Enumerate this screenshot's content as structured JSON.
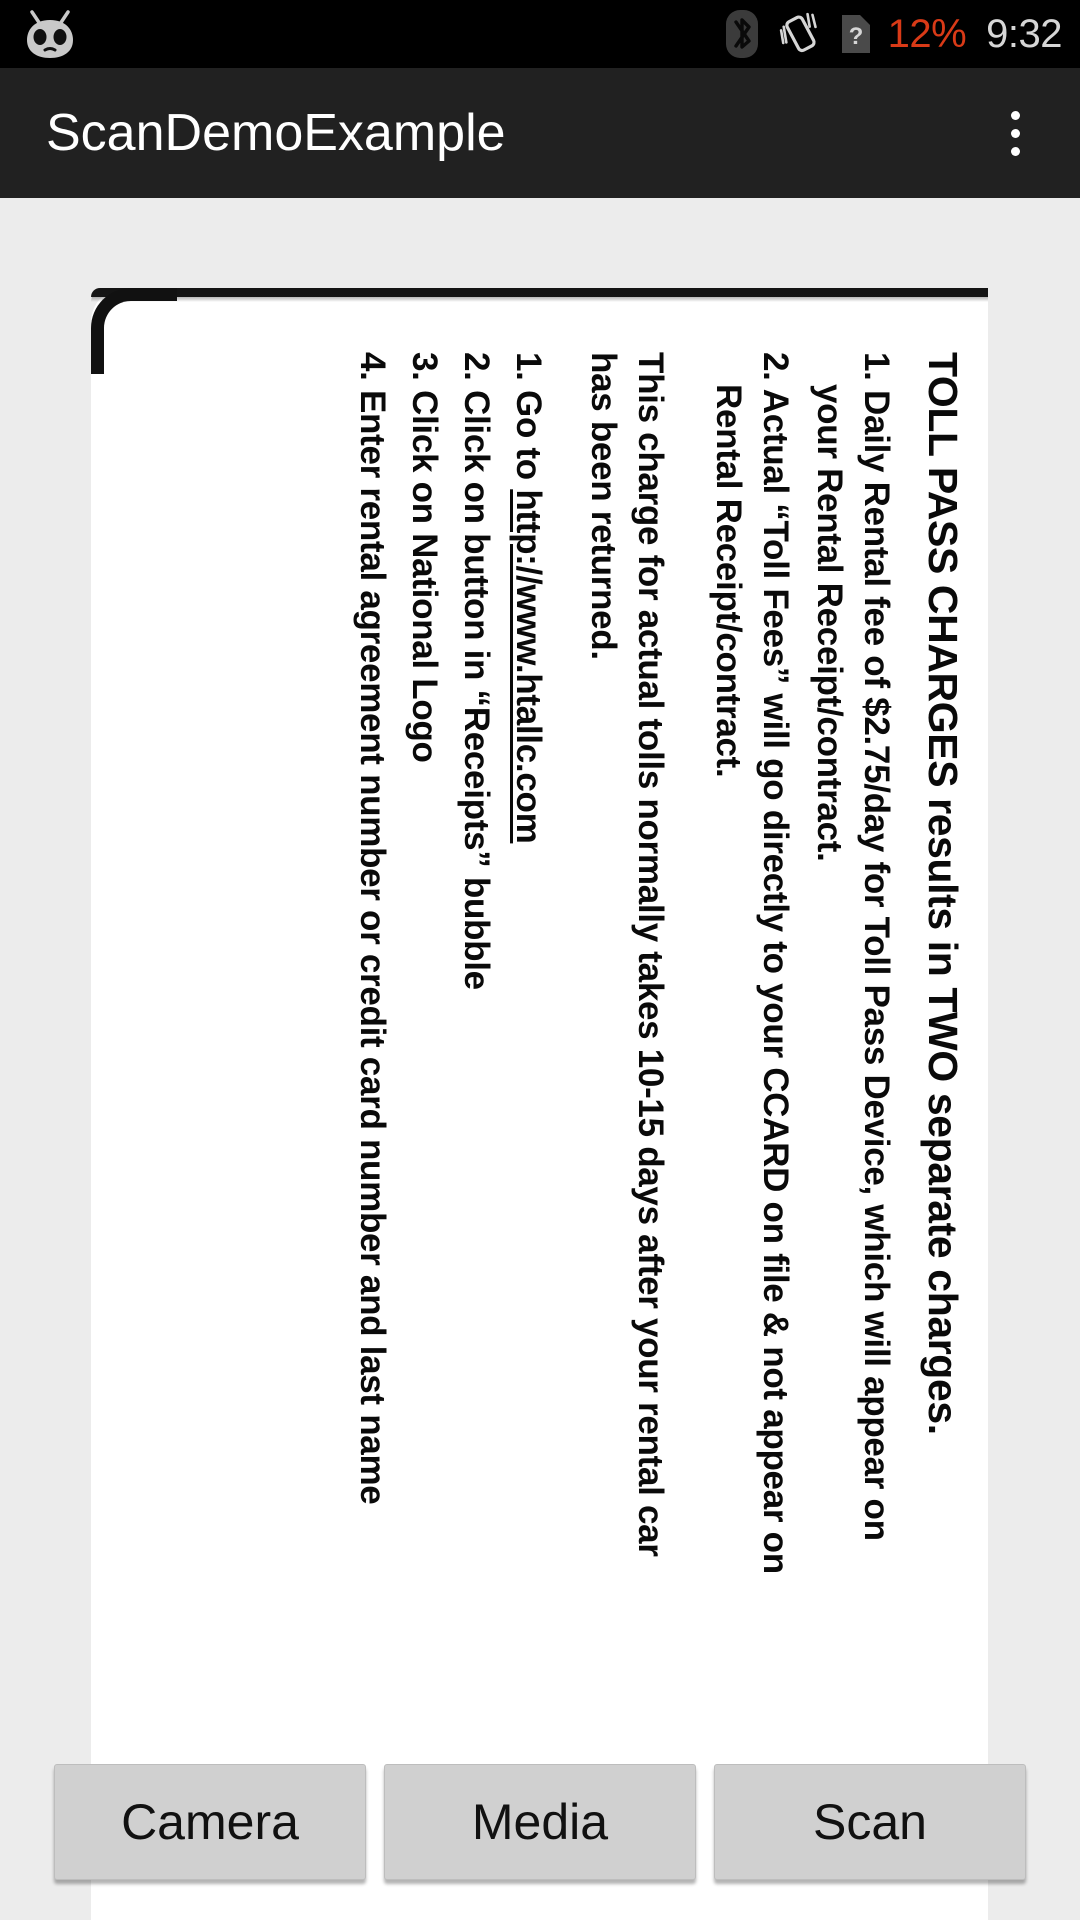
{
  "status_bar": {
    "icons": [
      {
        "name": "cyanogenmod-logo-icon"
      },
      {
        "name": "bluetooth-icon"
      },
      {
        "name": "vibrate-mode-icon"
      },
      {
        "name": "no-sim-card-icon"
      }
    ],
    "battery": "12%",
    "battery_color": "#d93a17",
    "time": "9:32",
    "time_color": "#d6d6d6",
    "background": "#000000"
  },
  "app_bar": {
    "title": "ScanDemoExample",
    "background": "#212121",
    "title_color": "#ffffff",
    "overflow_menu_icon": "more-vertical-icon"
  },
  "document": {
    "orientation": "rotated-90-clockwise",
    "paper_color": "#ffffff",
    "heading": "TOLL PASS CHARGES results in TWO separate charges.",
    "numbered_charges": [
      {
        "number": "1.",
        "lines": [
          "1. Daily Rental fee of $2.75/day for Toll Pass Device, which will appear on",
          "your Rental Receipt/contract."
        ]
      },
      {
        "number": "2.",
        "lines": [
          "2. Actual “Toll Fees” will go directly to your CCARD on file & not appear on",
          "Rental Receipt/contract."
        ]
      }
    ],
    "note": [
      "This charge for actual tolls normally takes 10-15 days after your rental car",
      "has been returned."
    ],
    "instructions": [
      {
        "number": "1.",
        "prefix": "1. Go to ",
        "link": "http://www.htallc.com",
        "suffix": ""
      },
      {
        "number": "2.",
        "text": "2. Click on button in “Receipts” bubble"
      },
      {
        "number": "3.",
        "text": "3. Click on National Logo"
      },
      {
        "number": "4.",
        "text": "4. Enter rental agreement number or credit card number and last name"
      }
    ]
  },
  "button_bar": {
    "buttons": [
      {
        "label": "Camera",
        "name": "camera-button"
      },
      {
        "label": "Media",
        "name": "media-button"
      },
      {
        "label": "Scan",
        "name": "scan-button"
      }
    ],
    "button_color": "#d0d0d0"
  },
  "colors": {
    "page_background": "#ececec",
    "ink": "#0a0a0a"
  }
}
